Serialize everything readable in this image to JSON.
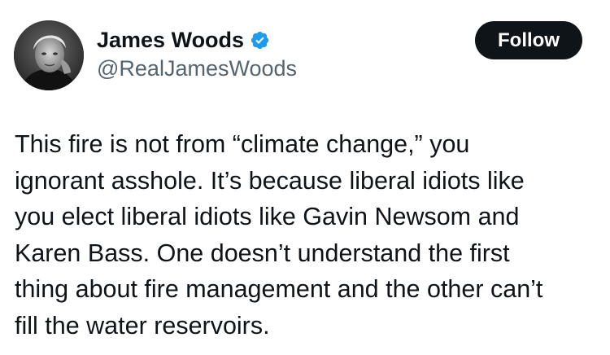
{
  "author": {
    "display_name": "James Woods",
    "handle": "@RealJamesWoods",
    "verified": true,
    "verified_color": "#1d9bf0",
    "avatar_icon": "profile-photo"
  },
  "actions": {
    "follow_label": "Follow"
  },
  "tweet": {
    "text": "This fire is not from “climate change,” you\nignorant asshole. It’s because liberal idiots like\nyou elect liberal idiots like Gavin Newsom and\nKaren Bass. One doesn’t understand the first\nthing about fire management and the other can’t\nfill the water reservoirs."
  },
  "colors": {
    "text_primary": "#0f1419",
    "text_secondary": "#536471",
    "button_bg": "#0f1419",
    "button_text": "#ffffff"
  }
}
